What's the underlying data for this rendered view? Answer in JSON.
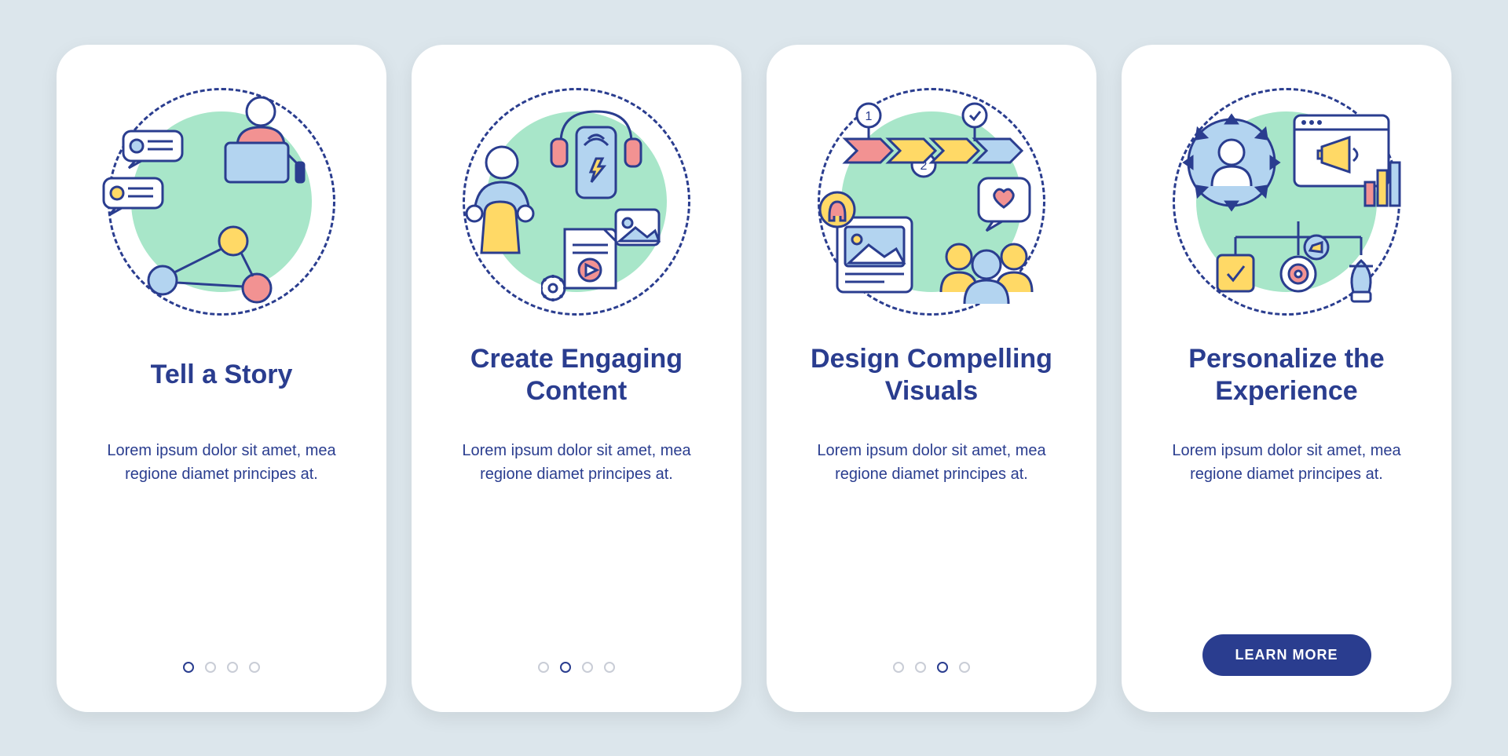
{
  "cards": [
    {
      "title": "Tell a Story",
      "body": "Lorem ipsum dolor sit amet, mea regione diamet principes at.",
      "active_dot": 0,
      "show_dots": true,
      "show_cta": false
    },
    {
      "title": "Create Engaging Content",
      "body": "Lorem ipsum dolor sit amet, mea regione diamet principes at.",
      "active_dot": 1,
      "show_dots": true,
      "show_cta": false
    },
    {
      "title": "Design Compelling Visuals",
      "body": "Lorem ipsum dolor sit amet, mea regione diamet principes at.",
      "active_dot": 2,
      "show_dots": true,
      "show_cta": false
    },
    {
      "title": "Personalize the Experience",
      "body": "Lorem ipsum dolor sit amet, mea regione diamet principes at.",
      "active_dot": 3,
      "show_dots": false,
      "show_cta": true
    }
  ],
  "cta_label": "LEARN MORE",
  "dot_count": 4,
  "colors": {
    "navy": "#2a3d8f",
    "blue": "#b3d4f0",
    "yellow": "#ffd966",
    "red": "#f29292",
    "green": "#a8e6c9",
    "bg": "#dce6ec"
  }
}
